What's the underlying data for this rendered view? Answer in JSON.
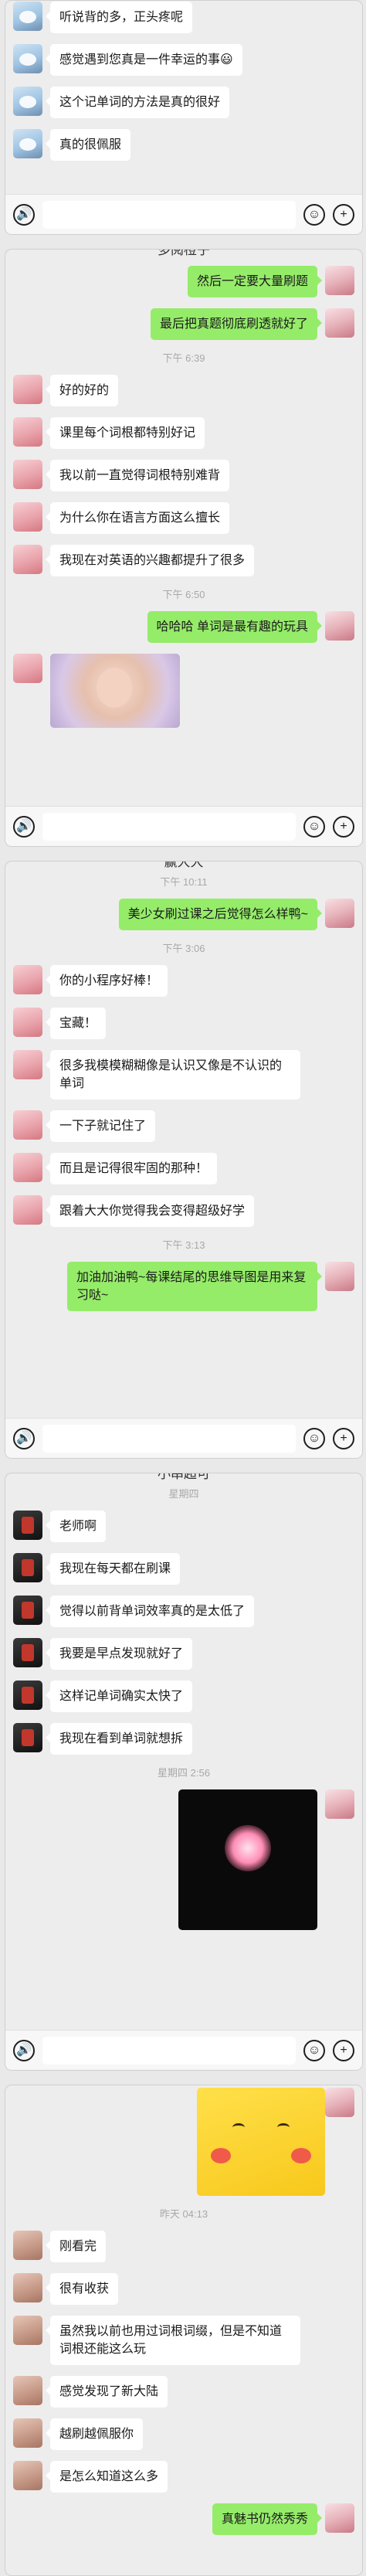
{
  "panels": [
    {
      "title": "",
      "rows": [
        {
          "type": "msg",
          "side": "other",
          "avatar": "a",
          "text": "听说背的多，正头疼呢"
        },
        {
          "type": "msg",
          "side": "other",
          "avatar": "a",
          "text": "感觉遇到您真是一件幸运的事😃"
        },
        {
          "type": "msg",
          "side": "other",
          "avatar": "a",
          "text": "这个记单词的方法是真的很好"
        },
        {
          "type": "msg",
          "side": "other",
          "avatar": "a",
          "text": "真的很佩服"
        }
      ]
    },
    {
      "title": "多阅橙子",
      "rows": [
        {
          "type": "msg",
          "side": "me",
          "text": "然后一定要大量刷题"
        },
        {
          "type": "msg",
          "side": "me",
          "text": "最后把真题彻底刷透就好了"
        },
        {
          "type": "time",
          "text": "下午 6:39"
        },
        {
          "type": "msg",
          "side": "other",
          "avatar": "b",
          "text": "好的好的"
        },
        {
          "type": "msg",
          "side": "other",
          "avatar": "b",
          "text": "课里每个词根都特别好记"
        },
        {
          "type": "msg",
          "side": "other",
          "avatar": "b",
          "text": "我以前一直觉得词根特别难背"
        },
        {
          "type": "msg",
          "side": "other",
          "avatar": "b",
          "text": "为什么你在语言方面这么擅长"
        },
        {
          "type": "msg",
          "side": "other",
          "avatar": "b",
          "text": "我现在对英语的兴趣都提升了很多"
        },
        {
          "type": "time",
          "text": "下午 6:50"
        },
        {
          "type": "msg",
          "side": "me",
          "text": "哈哈哈 单词是最有趣的玩具"
        },
        {
          "type": "photo",
          "side": "other",
          "avatar": "b",
          "kind": "kid"
        }
      ]
    },
    {
      "title": "赢大大",
      "rows": [
        {
          "type": "time",
          "text": "下午 10:11"
        },
        {
          "type": "msg",
          "side": "me",
          "text": "美少女刷过课之后觉得怎么样鸭~"
        },
        {
          "type": "time",
          "text": "下午 3:06"
        },
        {
          "type": "msg",
          "side": "other",
          "avatar": "b",
          "text": "你的小程序好棒！"
        },
        {
          "type": "msg",
          "side": "other",
          "avatar": "b",
          "text": "宝藏！"
        },
        {
          "type": "msg",
          "side": "other",
          "avatar": "b",
          "text": "很多我模模糊糊像是认识又像是不认识的单词"
        },
        {
          "type": "msg",
          "side": "other",
          "avatar": "b",
          "text": "一下子就记住了"
        },
        {
          "type": "msg",
          "side": "other",
          "avatar": "b",
          "text": "而且是记得很牢固的那种！"
        },
        {
          "type": "msg",
          "side": "other",
          "avatar": "b",
          "text": "跟着大大你觉得我会变得超级好学"
        },
        {
          "type": "time",
          "text": "下午 3:13"
        },
        {
          "type": "msg",
          "side": "me",
          "text": "加油加油鸭~每课结尾的思维导图是用来复习哒~"
        }
      ]
    },
    {
      "title": "小串超可",
      "rows": [
        {
          "type": "time",
          "text": "星期四"
        },
        {
          "type": "msg",
          "side": "other",
          "avatar": "c",
          "text": "老师啊"
        },
        {
          "type": "msg",
          "side": "other",
          "avatar": "c",
          "text": "我现在每天都在刷课"
        },
        {
          "type": "msg",
          "side": "other",
          "avatar": "c",
          "text": "觉得以前背单词效率真的是太低了"
        },
        {
          "type": "msg",
          "side": "other",
          "avatar": "c",
          "text": "我要是早点发现就好了"
        },
        {
          "type": "msg",
          "side": "other",
          "avatar": "c",
          "text": "这样记单词确实太快了"
        },
        {
          "type": "msg",
          "side": "other",
          "avatar": "c",
          "text": "我现在看到单词就想拆"
        },
        {
          "type": "time",
          "text": "星期四 2:56"
        },
        {
          "type": "photo",
          "side": "me",
          "kind": "heart"
        }
      ]
    },
    {
      "title": "",
      "rows": [
        {
          "type": "photo",
          "side": "me",
          "kind": "pika"
        },
        {
          "type": "time",
          "text": "昨天 04:13"
        },
        {
          "type": "msg",
          "side": "other",
          "avatar": "d",
          "text": "刚看完"
        },
        {
          "type": "msg",
          "side": "other",
          "avatar": "d",
          "text": "很有收获"
        },
        {
          "type": "msg",
          "side": "other",
          "avatar": "d",
          "text": "虽然我以前也用过词根词缀，但是不知道词根还能这么玩"
        },
        {
          "type": "msg",
          "side": "other",
          "avatar": "d",
          "text": "感觉发现了新大陆"
        },
        {
          "type": "msg",
          "side": "other",
          "avatar": "d",
          "text": "越刷越佩服你"
        },
        {
          "type": "msg",
          "side": "other",
          "avatar": "d",
          "text": "是怎么知道这么多"
        },
        {
          "type": "msg",
          "side": "me",
          "text": "真魅书仍然秀秀"
        }
      ]
    }
  ],
  "inputbar": {
    "voice_icon": "voice-icon",
    "emoji_icon": "emoji-icon",
    "plus_icon": "plus-icon",
    "voice_glyph": "🔊",
    "emoji_glyph": "☺",
    "plus_glyph": "+"
  }
}
